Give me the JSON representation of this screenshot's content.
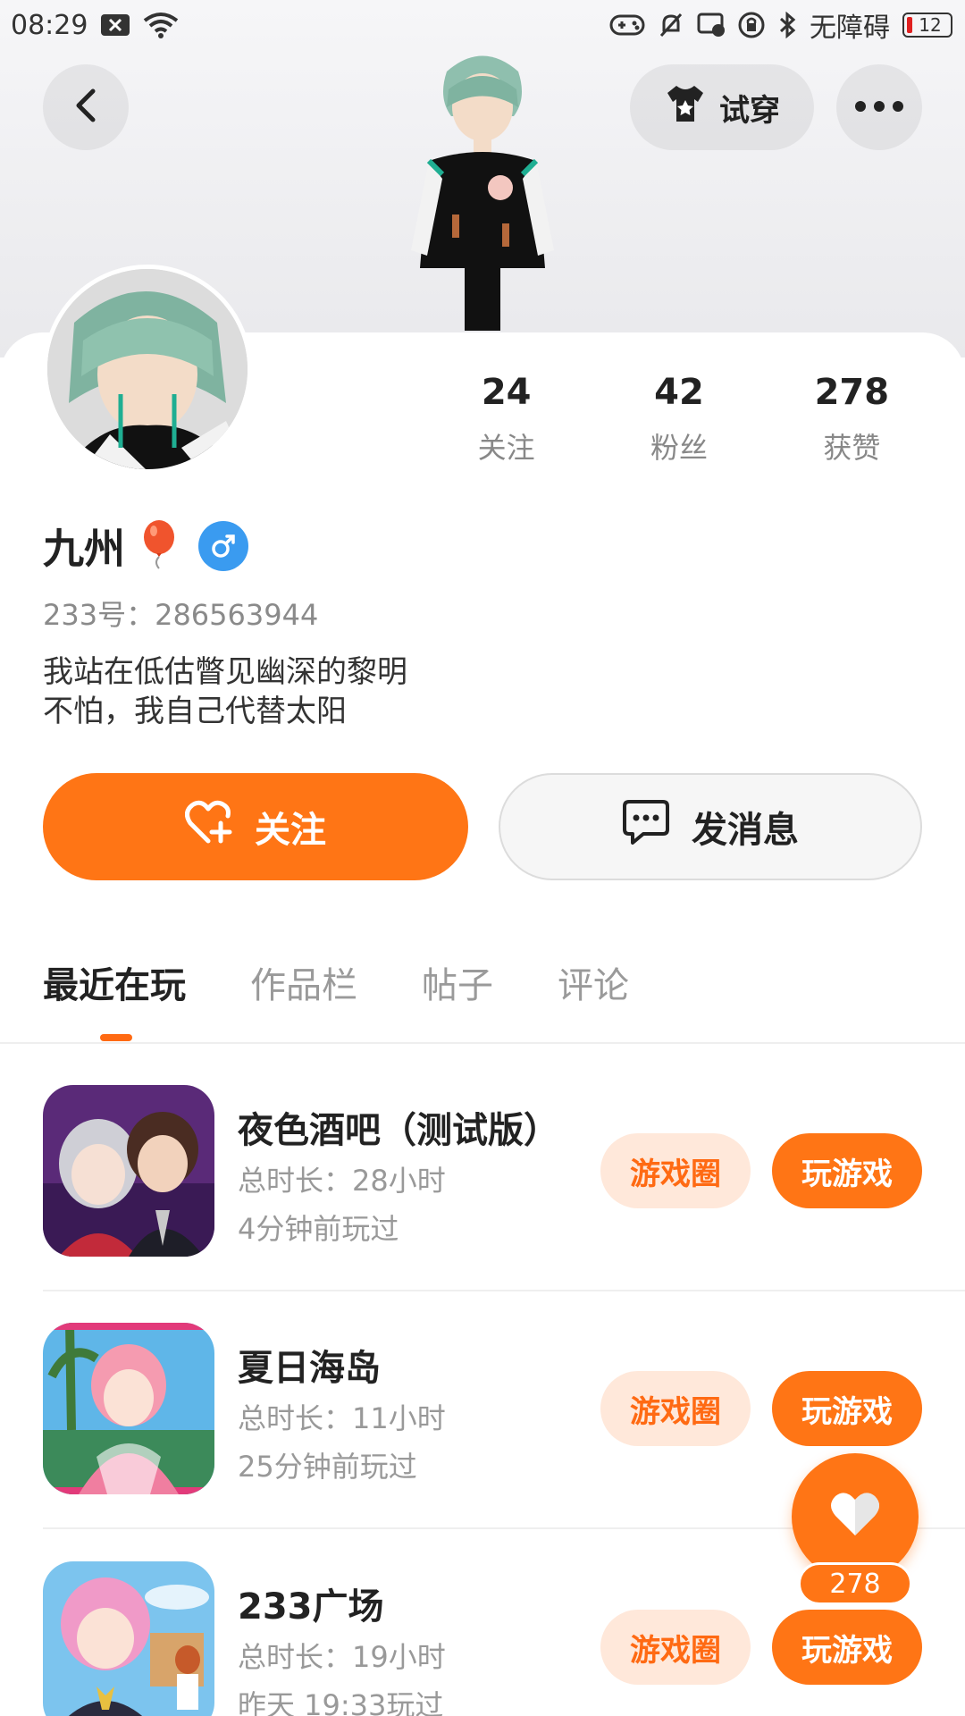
{
  "status_bar": {
    "time": "08:29",
    "accessibility_label": "无障碍",
    "battery": "12"
  },
  "header": {
    "try_on_label": "试穿"
  },
  "profile": {
    "stats": [
      {
        "num": "24",
        "label": "关注"
      },
      {
        "num": "42",
        "label": "粉丝"
      },
      {
        "num": "278",
        "label": "获赞"
      }
    ],
    "name": "九州",
    "name_emoji": "🎈",
    "id_line": "233号：286563944",
    "bio_line1": "我站在低估瞥见幽深的黎明",
    "bio_line2": "不怕，我自己代替太阳"
  },
  "actions": {
    "follow_label": "关注",
    "message_label": "发消息"
  },
  "tabs": [
    {
      "label": "最近在玩",
      "active": true
    },
    {
      "label": "作品栏",
      "active": false
    },
    {
      "label": "帖子",
      "active": false
    },
    {
      "label": "评论",
      "active": false
    }
  ],
  "games": [
    {
      "title": "夜色酒吧（测试版）",
      "duration": "总时长：28小时",
      "last_played": "4分钟前玩过",
      "circle_label": "游戏圈",
      "play_label": "玩游戏"
    },
    {
      "title": "夏日海岛",
      "duration": "总时长：11小时",
      "last_played": "25分钟前玩过",
      "circle_label": "游戏圈",
      "play_label": "玩游戏"
    },
    {
      "title": "233广场",
      "duration": "总时长：19小时",
      "last_played": "昨天 19:33玩过",
      "circle_label": "游戏圈",
      "play_label": "玩游戏"
    }
  ],
  "like_fab": {
    "count": "278"
  },
  "colors": {
    "accent": "#ff7515",
    "accent_light": "#ffe8da",
    "gender_blue": "#3a9bf0"
  }
}
